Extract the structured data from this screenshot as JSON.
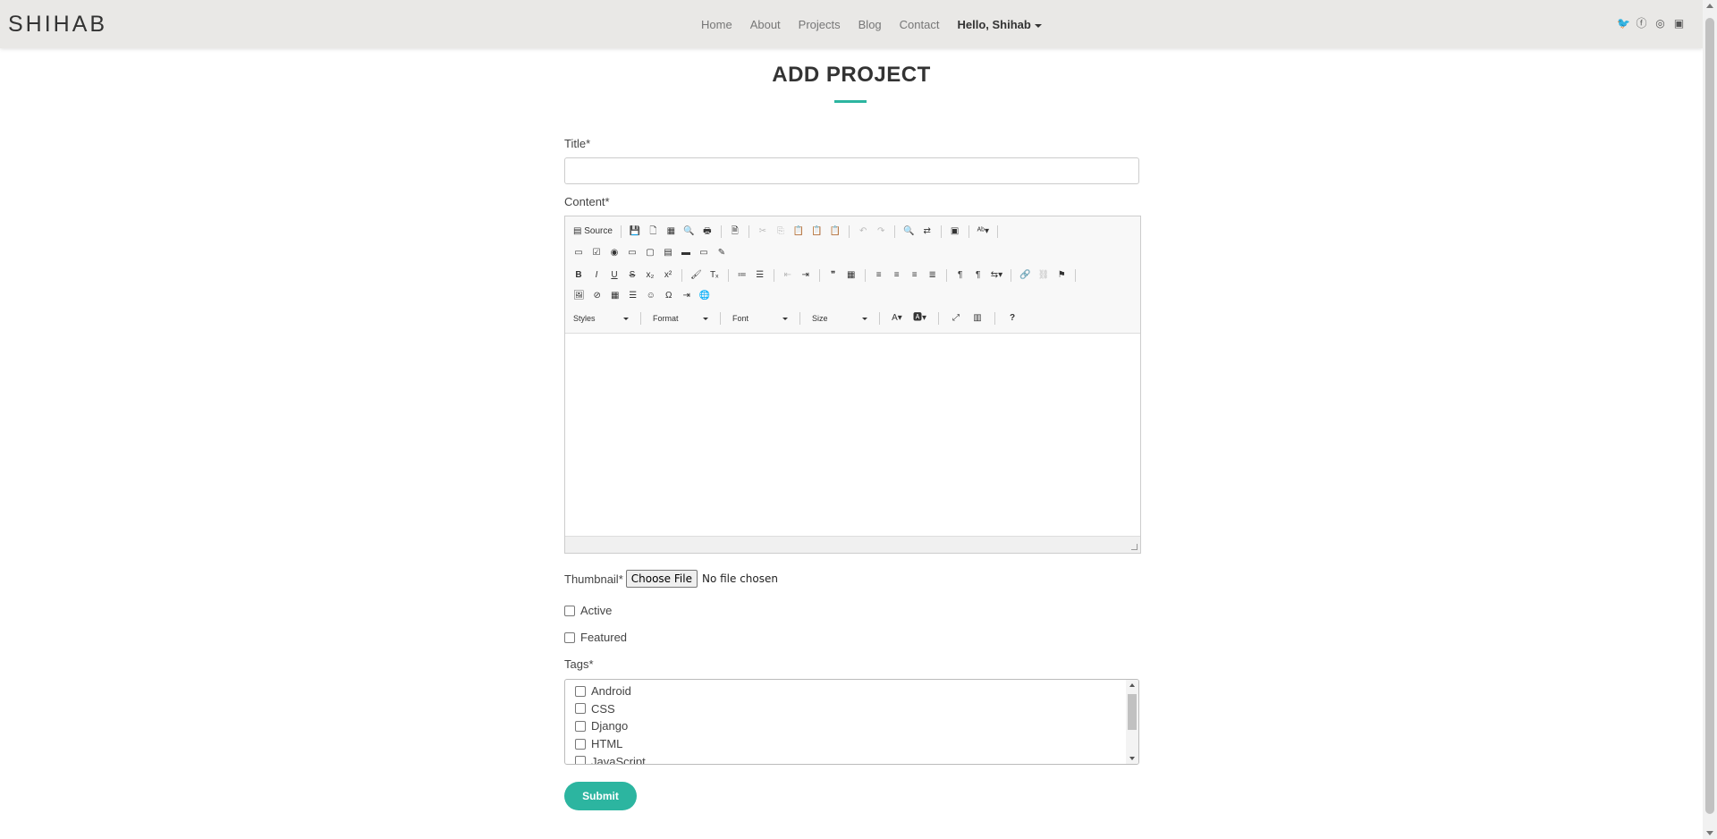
{
  "navbar": {
    "brand": "SHIHAB",
    "links": [
      "Home",
      "About",
      "Projects",
      "Blog",
      "Contact"
    ],
    "user_menu": "Hello, Shihab",
    "social_icons": [
      "twitter-icon",
      "facebook-icon",
      "instagram-icon",
      "linkedin-icon"
    ]
  },
  "page": {
    "title": "ADD PROJECT"
  },
  "form": {
    "title_label": "Title*",
    "title_value": "",
    "content_label": "Content*",
    "thumbnail_label": "Thumbnail*",
    "file_button": "Choose File",
    "file_status": "No file chosen",
    "active_label": "Active",
    "featured_label": "Featured",
    "tags_label": "Tags*",
    "tags": [
      "Android",
      "CSS",
      "Django",
      "HTML",
      "JavaScript"
    ],
    "submit_label": "Submit"
  },
  "editor": {
    "source_label": "Source",
    "styles_label": "Styles",
    "format_label": "Format",
    "font_label": "Font",
    "size_label": "Size"
  },
  "colors": {
    "accent": "#2cb5a0",
    "navbar_bg": "#e9e8e6"
  }
}
